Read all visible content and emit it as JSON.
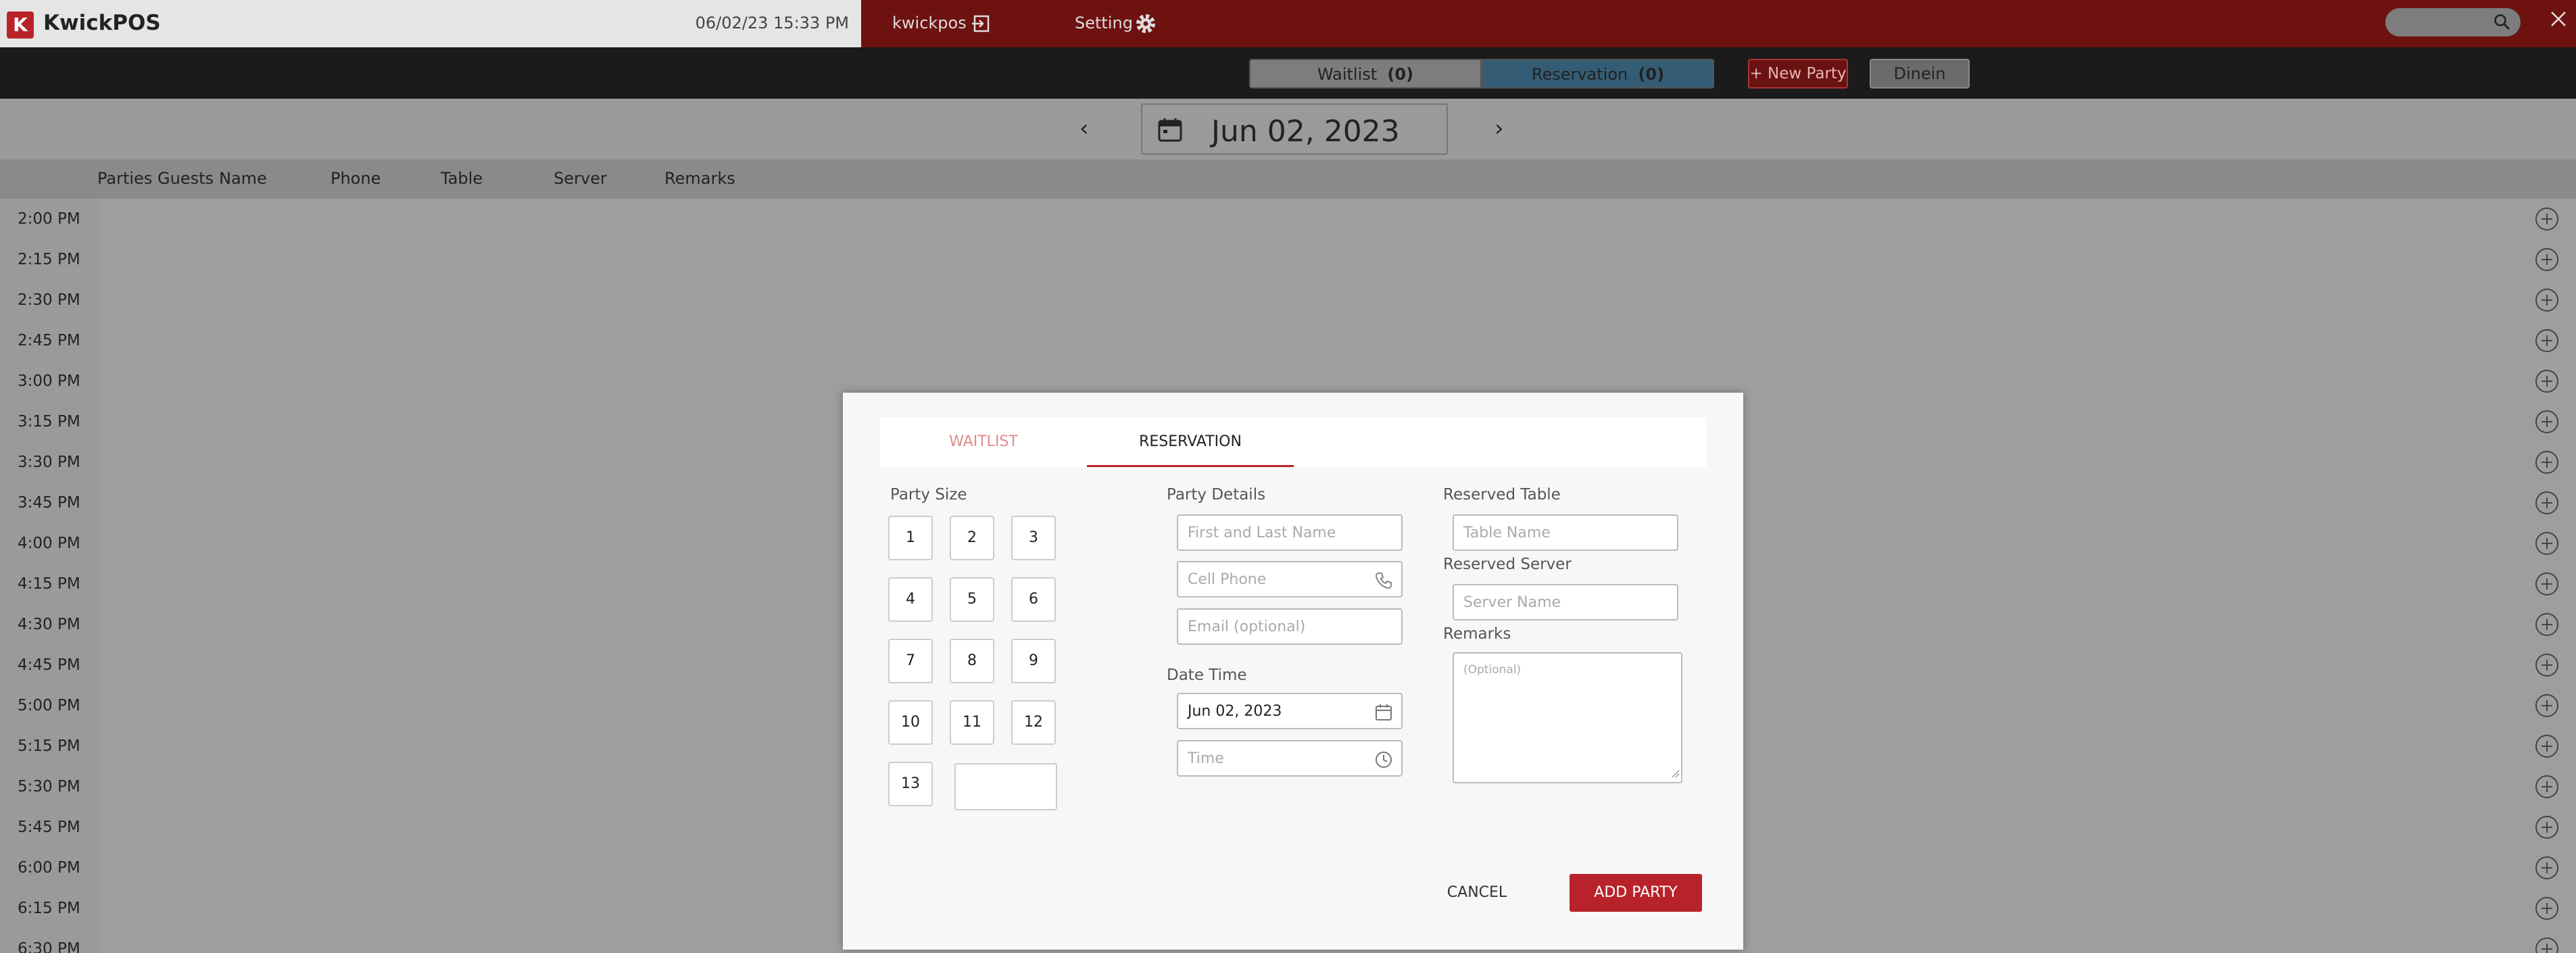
{
  "app": {
    "logo_letter": "K",
    "brand": "KwickPOS",
    "datetime": "06/02/23 15:33 PM",
    "user": "kwickpos",
    "setting_label": "Setting"
  },
  "toolbar": {
    "waitlist_label": "Waitlist",
    "waitlist_count": "(0)",
    "reservation_label": "Reservation",
    "reservation_count": "(0)",
    "new_party_label": "+ New Party",
    "dinein_label": "Dinein"
  },
  "date_nav": {
    "prev": "‹",
    "next": "›",
    "date": "Jun 02, 2023"
  },
  "columns": [
    "Parties",
    "Guests",
    "Name",
    "Phone",
    "Table",
    "Server",
    "Remarks"
  ],
  "time_slots": [
    "2:00 PM",
    "2:15 PM",
    "2:30 PM",
    "2:45 PM",
    "3:00 PM",
    "3:15 PM",
    "3:30 PM",
    "3:45 PM",
    "4:00 PM",
    "4:15 PM",
    "4:30 PM",
    "4:45 PM",
    "5:00 PM",
    "5:15 PM",
    "5:30 PM",
    "5:45 PM",
    "6:00 PM",
    "6:15 PM",
    "6:30 PM"
  ],
  "modal": {
    "tab_waitlist": "WAITLIST",
    "tab_reservation": "RESERVATION",
    "party_size_label": "Party Size",
    "party_sizes": [
      "1",
      "2",
      "3",
      "4",
      "5",
      "6",
      "7",
      "8",
      "9",
      "10",
      "11",
      "12",
      "13"
    ],
    "party_details_label": "Party Details",
    "name_placeholder": "First and Last Name",
    "phone_placeholder": "Cell Phone",
    "email_placeholder": "Email (optional)",
    "date_time_label": "Date Time",
    "date_value": "Jun 02, 2023",
    "time_placeholder": "Time",
    "reserved_table_label": "Reserved Table",
    "table_placeholder": "Table Name",
    "reserved_server_label": "Reserved Server",
    "server_placeholder": "Server Name",
    "remarks_label": "Remarks",
    "remarks_placeholder": "(Optional)",
    "cancel_label": "CANCEL",
    "add_party_label": "ADD PARTY"
  },
  "colors": {
    "accent": "#b8232a",
    "topbar_red": "#6e1111",
    "reservation_active": "#345d75"
  }
}
